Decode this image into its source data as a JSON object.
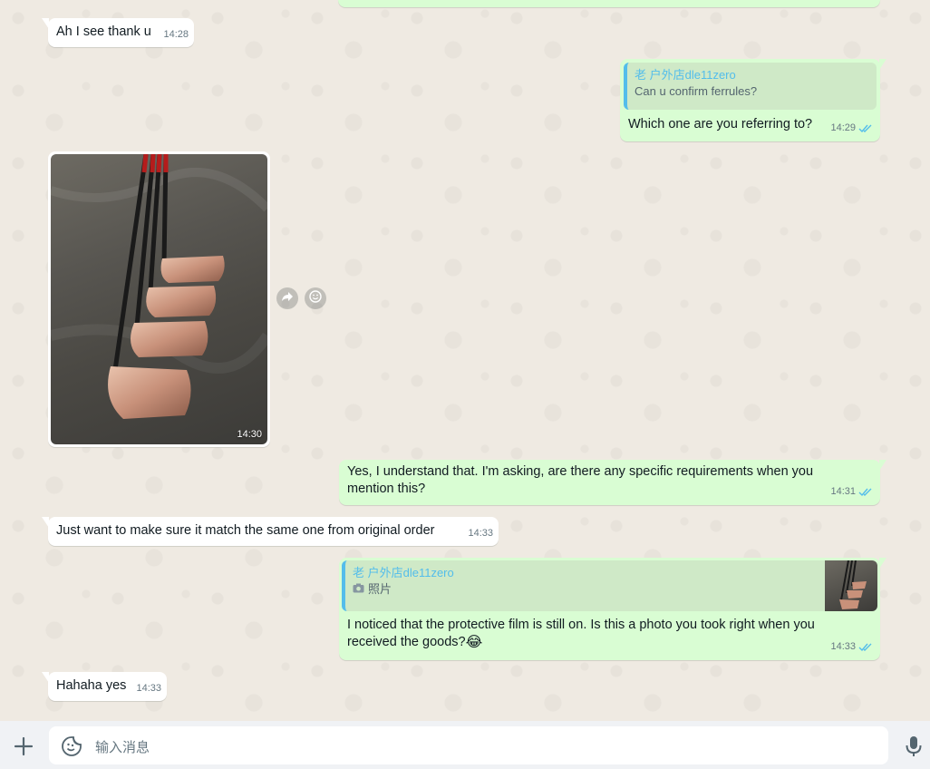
{
  "messages": {
    "m1": {
      "text": "Ah I see thank u",
      "time": "14:28"
    },
    "m2": {
      "quote_author": "老 户外店dle11zero",
      "quote_text": "Can u confirm ferrules?",
      "text": "Which one are you referring to?",
      "time": "14:29"
    },
    "m3": {
      "time": "14:30"
    },
    "m4": {
      "line1": "Yes, I understand that. I'm asking, are there any specific requirements when you",
      "line2": "mention this?",
      "time": "14:31"
    },
    "m5": {
      "text": "Just want to make sure it match the same one from original order",
      "time": "14:33"
    },
    "m6": {
      "quote_author": "老 户外店dle11zero",
      "quote_text": "照片",
      "line1": "I noticed that the protective film is still on. Is this a photo you took right when you",
      "line2": "received the goods?",
      "emoji": "😂",
      "time": "14:33"
    },
    "m7": {
      "text": "Hahaha yes",
      "time": "14:33"
    }
  },
  "composer": {
    "placeholder": "输入消息"
  },
  "icons": {
    "attach": "plus-icon",
    "sticker": "sticker-icon",
    "mic": "microphone-icon",
    "forward": "forward-icon",
    "react": "emoji-react-icon",
    "read": "double-check-icon",
    "camera": "camera-icon"
  },
  "colors": {
    "incoming": "#ffffff",
    "outgoing": "#d9fdd3",
    "read_ticks": "#53bdeb",
    "quote_bar": "#53bdeb"
  }
}
